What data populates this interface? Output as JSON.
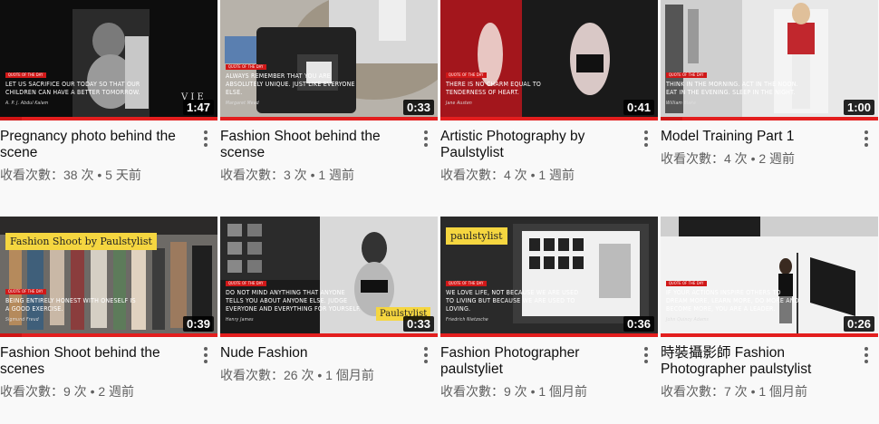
{
  "videos": [
    {
      "title": "Pregnancy photo behind the scene",
      "views": "收看次數：38 次",
      "age": "5 天前",
      "duration": "1:47",
      "thumb_quote": "LET US SACRIFICE OUR TODAY SO THAT OUR CHILDREN CAN HAVE A BETTER TOMORROW.",
      "thumb_author": "A. P. J. Abdul Kalam",
      "thumb_tag": "QUOTE OF THE DAY",
      "overlay_title": "",
      "progress": 0.1
    },
    {
      "title": "Fashion Shoot behind the scense",
      "views": "收看次數：3 次",
      "age": "1 週前",
      "duration": "0:33",
      "thumb_quote": "ALWAYS REMEMBER THAT YOU ARE ABSOLUTELY UNIQUE. JUST LIKE EVERYONE ELSE.",
      "thumb_author": "Margaret Mead",
      "thumb_tag": "QUOTE OF THE DAY",
      "overlay_title": "",
      "progress": 0.0
    },
    {
      "title": "Artistic Photography by Paulstylist",
      "views": "收看次數：4 次",
      "age": "1 週前",
      "duration": "0:41",
      "thumb_quote": "THERE IS NO CHARM EQUAL TO TENDERNESS OF HEART.",
      "thumb_author": "Jane Austen",
      "thumb_tag": "QUOTE OF THE DAY",
      "overlay_title": "",
      "progress": 0.0
    },
    {
      "title": "Model Training Part 1",
      "views": "收看次數：4 次",
      "age": "2 週前",
      "duration": "1:00",
      "thumb_quote": "THINK IN THE MORNING. ACT IN THE NOON. EAT IN THE EVENING. SLEEP IN THE NIGHT.",
      "thumb_author": "William Blake",
      "thumb_tag": "QUOTE OF THE DAY",
      "overlay_title": "",
      "progress": 0.1
    },
    {
      "title": "Fashion Shoot behind the scenes",
      "views": "收看次數：9 次",
      "age": "2 週前",
      "duration": "0:39",
      "thumb_quote": "BEING ENTIRELY HONEST WITH ONESELF IS A GOOD EXERCISE.",
      "thumb_author": "Sigmund Freud",
      "thumb_tag": "QUOTE OF THE DAY",
      "overlay_title": "Fashion Shoot by Paulstylist",
      "progress": 0.1
    },
    {
      "title": "Nude Fashion",
      "views": "收看次數：26 次",
      "age": "1 個月前",
      "duration": "0:33",
      "thumb_quote": "DO NOT MIND ANYTHING THAT ANYONE TELLS YOU ABOUT ANYONE ELSE. JUDGE EVERYONE AND EVERYTHING FOR YOURSELF.",
      "thumb_author": "Henry James",
      "thumb_tag": "QUOTE OF THE DAY",
      "overlay_title": "Paulstylist",
      "progress": 0.0
    },
    {
      "title": "Fashion Photographer paulstyliet",
      "views": "收看次數：9 次",
      "age": "1 個月前",
      "duration": "0:36",
      "thumb_quote": "WE LOVE LIFE, NOT BECAUSE WE ARE USED TO LIVING BUT BECAUSE WE ARE USED TO LOVING.",
      "thumb_author": "Friedrich Nietzsche",
      "thumb_tag": "QUOTE OF THE DAY",
      "overlay_title": "paulstylist",
      "progress": 0.0
    },
    {
      "title": "時裝攝影師 Fashion Photographer paulstylist",
      "views": "收看次數：7 次",
      "age": "1 個月前",
      "duration": "0:26",
      "thumb_quote": "IF YOUR ACTIONS INSPIRE OTHERS TO DREAM MORE, LEARN MORE, DO MORE AND BECOME MORE, YOU ARE A LEADER.",
      "thumb_author": "John Quincy Adams",
      "thumb_tag": "QUOTE OF THE DAY",
      "overlay_title": "",
      "progress": 0.0
    }
  ],
  "separator": " • "
}
